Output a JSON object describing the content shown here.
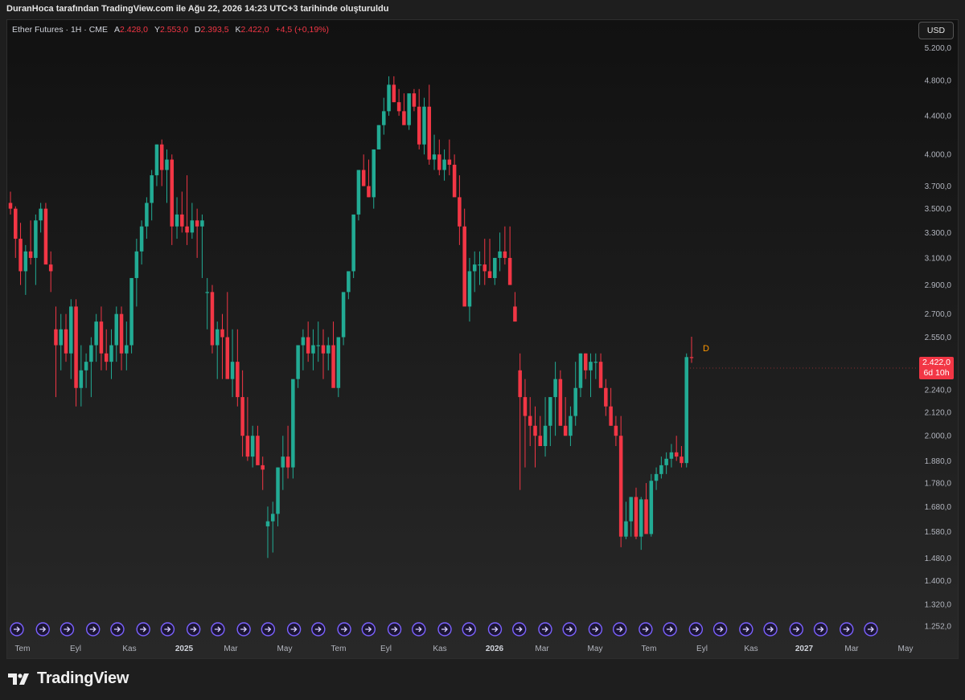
{
  "header": {
    "caption": "DuranHoca tarafından TradingView.com ile Ağu 22, 2026 14:23 UTC+3 tarihinde oluşturuldu"
  },
  "legend": {
    "symbol": "Ether Futures · 1H · CME",
    "open_label": "A",
    "open": "2.428,0",
    "high_label": "Y",
    "high": "2.553,0",
    "low_label": "D",
    "low": "2.393,5",
    "close_label": "K",
    "close": "2.422,0",
    "change": "+4,5 (+0,19%)"
  },
  "currency_button": "USD",
  "last_price": {
    "value": "2.422,0",
    "countdown": "6d 10h"
  },
  "marker_label": "D",
  "branding": {
    "logo_text": "TradingView"
  },
  "colors": {
    "up": "#22ab94",
    "down": "#f23645",
    "event_icon": "#7b61ff",
    "marker": "#ff9800"
  },
  "event_icons": {
    "icon": "arrow-circle-icon",
    "count": 35
  },
  "chart_data": {
    "type": "candlestick",
    "yscale": "log",
    "ylim": [
      1210,
      5450
    ],
    "y_ticks": [
      "5.200,0",
      "4.800,0",
      "4.400,0",
      "4.000,0",
      "3.700,0",
      "3.500,0",
      "3.300,0",
      "3.100,0",
      "2.900,0",
      "2.700,0",
      "2.550,0",
      "2.240,0",
      "2.120,0",
      "2.000,0",
      "1.880,0",
      "1.780,0",
      "1.680,0",
      "1.580,0",
      "1.480,0",
      "1.400,0",
      "1.320,0",
      "1.252,0"
    ],
    "x_ticks": [
      {
        "label": "Tem",
        "bold": false
      },
      {
        "label": "Eyl",
        "bold": false
      },
      {
        "label": "Kas",
        "bold": false
      },
      {
        "label": "2025",
        "bold": true
      },
      {
        "label": "Mar",
        "bold": false
      },
      {
        "label": "May",
        "bold": false
      },
      {
        "label": "Tem",
        "bold": false
      },
      {
        "label": "Eyl",
        "bold": false
      },
      {
        "label": "Kas",
        "bold": false
      },
      {
        "label": "2026",
        "bold": true
      },
      {
        "label": "Mar",
        "bold": false
      },
      {
        "label": "May",
        "bold": false
      },
      {
        "label": "Tem",
        "bold": false
      },
      {
        "label": "Eyl",
        "bold": false
      },
      {
        "label": "Kas",
        "bold": false
      },
      {
        "label": "2027",
        "bold": true
      },
      {
        "label": "Mar",
        "bold": false
      },
      {
        "label": "May",
        "bold": false
      }
    ],
    "candles": [
      [
        3550,
        3650,
        3450,
        3500
      ],
      [
        3500,
        3520,
        3100,
        3250
      ],
      [
        3250,
        3380,
        2900,
        3000
      ],
      [
        3000,
        3200,
        2830,
        3150
      ],
      [
        3150,
        3400,
        3050,
        3100
      ],
      [
        3100,
        3450,
        2900,
        3400
      ],
      [
        3400,
        3550,
        3300,
        3500
      ],
      [
        3500,
        3550,
        3100,
        3050
      ],
      [
        3050,
        3150,
        2850,
        3000
      ],
      [
        2600,
        2750,
        2200,
        2500
      ],
      [
        2500,
        2700,
        2350,
        2600
      ],
      [
        2600,
        2700,
        2400,
        2450
      ],
      [
        2450,
        2800,
        2300,
        2750
      ],
      [
        2750,
        2800,
        2150,
        2250
      ],
      [
        2250,
        2500,
        2150,
        2350
      ],
      [
        2350,
        2450,
        2250,
        2400
      ],
      [
        2400,
        2550,
        2200,
        2500
      ],
      [
        2500,
        2700,
        2400,
        2650
      ],
      [
        2650,
        2750,
        2350,
        2450
      ],
      [
        2450,
        2600,
        2350,
        2400
      ],
      [
        2400,
        2600,
        2300,
        2500
      ],
      [
        2500,
        2750,
        2400,
        2700
      ],
      [
        2700,
        2750,
        2350,
        2450
      ],
      [
        2450,
        2650,
        2350,
        2500
      ],
      [
        2500,
        2950,
        2450,
        2950
      ],
      [
        2950,
        3250,
        2750,
        3150
      ],
      [
        3150,
        3400,
        3050,
        3350
      ],
      [
        3350,
        3600,
        3250,
        3550
      ],
      [
        3550,
        3850,
        3400,
        3800
      ],
      [
        3800,
        4100,
        3700,
        4100
      ],
      [
        4100,
        4150,
        3700,
        3850
      ],
      [
        3850,
        4050,
        3550,
        3950
      ],
      [
        3950,
        4000,
        3200,
        3350
      ],
      [
        3350,
        3600,
        3250,
        3450
      ],
      [
        3450,
        3650,
        3300,
        3350
      ],
      [
        3350,
        3800,
        3200,
        3300
      ],
      [
        3300,
        3550,
        3250,
        3400
      ],
      [
        3400,
        3500,
        3100,
        3350
      ],
      [
        3350,
        3450,
        2950,
        3400
      ],
      [
        2850,
        2950,
        2600,
        2850
      ],
      [
        2850,
        2900,
        2450,
        2500
      ],
      [
        2500,
        2650,
        2300,
        2600
      ],
      [
        2600,
        2700,
        2300,
        2550
      ],
      [
        2550,
        2850,
        2500,
        2300
      ],
      [
        2300,
        2600,
        2200,
        2400
      ],
      [
        2400,
        2600,
        2150,
        2200
      ],
      [
        2200,
        2350,
        1900,
        2000
      ],
      [
        2000,
        2200,
        1880,
        1900
      ],
      [
        1900,
        2050,
        1850,
        2000
      ],
      [
        2000,
        2050,
        1880,
        1860
      ],
      [
        1860,
        1900,
        1750,
        1840
      ],
      [
        1600,
        1680,
        1480,
        1620
      ],
      [
        1620,
        1700,
        1500,
        1650
      ],
      [
        1650,
        1850,
        1600,
        1850
      ],
      [
        1850,
        2000,
        1750,
        1900
      ],
      [
        1900,
        2050,
        1800,
        1850
      ],
      [
        1850,
        2250,
        1800,
        2300
      ],
      [
        2300,
        2500,
        2250,
        2500
      ],
      [
        2500,
        2600,
        2350,
        2550
      ],
      [
        2550,
        2650,
        2400,
        2450
      ],
      [
        2450,
        2600,
        2350,
        2500
      ],
      [
        2500,
        2650,
        2400,
        2500
      ],
      [
        2500,
        2600,
        2300,
        2450
      ],
      [
        2450,
        2550,
        2350,
        2500
      ],
      [
        2500,
        2650,
        2400,
        2250
      ],
      [
        2250,
        2550,
        2200,
        2550
      ],
      [
        2550,
        2800,
        2500,
        2850
      ],
      [
        2850,
        3000,
        2800,
        3000
      ],
      [
        3000,
        3350,
        2950,
        3450
      ],
      [
        3450,
        3800,
        3400,
        3850
      ],
      [
        3850,
        4000,
        3700,
        3700
      ],
      [
        3700,
        3950,
        3600,
        3600
      ],
      [
        3600,
        4050,
        3500,
        4050
      ],
      [
        4050,
        4300,
        4050,
        4300
      ],
      [
        4300,
        4600,
        4200,
        4450
      ],
      [
        4450,
        4850,
        4400,
        4750
      ],
      [
        4750,
        4850,
        4550,
        4550
      ],
      [
        4550,
        4700,
        4400,
        4450
      ],
      [
        4450,
        4650,
        4350,
        4300
      ],
      [
        4300,
        4600,
        4250,
        4650
      ],
      [
        4650,
        4700,
        4450,
        4500
      ],
      [
        4500,
        4700,
        4050,
        4100
      ],
      [
        4100,
        4600,
        4000,
        4500
      ],
      [
        4500,
        4750,
        3900,
        3950
      ],
      [
        3950,
        4200,
        3850,
        4000
      ],
      [
        4000,
        4150,
        3800,
        3850
      ],
      [
        3850,
        4050,
        3750,
        3950
      ],
      [
        3950,
        4150,
        3800,
        3900
      ],
      [
        3900,
        4000,
        3750,
        3600
      ],
      [
        3600,
        3800,
        3200,
        3350
      ],
      [
        3350,
        3500,
        3000,
        2750
      ],
      [
        2750,
        3100,
        2650,
        3000
      ],
      [
        3000,
        3150,
        2850,
        3050
      ],
      [
        3050,
        3150,
        2900,
        3050
      ],
      [
        3050,
        3250,
        2900,
        3000
      ],
      [
        3000,
        3250,
        2950,
        2950
      ],
      [
        2950,
        3100,
        2900,
        3100
      ],
      [
        3100,
        3300,
        3000,
        3150
      ],
      [
        3150,
        3350,
        3050,
        3100
      ],
      [
        3100,
        3350,
        2900,
        2900
      ],
      [
        2750,
        2850,
        2650,
        2650
      ],
      [
        2350,
        2450,
        1750,
        2200
      ],
      [
        2200,
        2300,
        1850,
        2100
      ],
      [
        2100,
        2200,
        1950,
        2050
      ],
      [
        2050,
        2150,
        1850,
        2000
      ],
      [
        2000,
        2100,
        1950,
        1950
      ],
      [
        1950,
        2200,
        1900,
        2050
      ],
      [
        2050,
        2200,
        1950,
        2200
      ],
      [
        2200,
        2400,
        2000,
        2300
      ],
      [
        2300,
        2350,
        2050,
        2050
      ],
      [
        2050,
        2200,
        2000,
        2000
      ],
      [
        2000,
        2150,
        1950,
        2100
      ],
      [
        2100,
        2400,
        2050,
        2250
      ],
      [
        2250,
        2450,
        2200,
        2450
      ],
      [
        2450,
        2450,
        2300,
        2350
      ],
      [
        2350,
        2450,
        2200,
        2400
      ],
      [
        2400,
        2450,
        2300,
        2400
      ],
      [
        2400,
        2450,
        2300,
        2250
      ],
      [
        2250,
        2300,
        2100,
        2150
      ],
      [
        2150,
        2250,
        2050,
        2050
      ],
      [
        2050,
        2100,
        1950,
        2000
      ],
      [
        2000,
        2100,
        1520,
        1560
      ],
      [
        1560,
        1700,
        1550,
        1620
      ],
      [
        1620,
        1720,
        1560,
        1720
      ],
      [
        1720,
        1760,
        1550,
        1560
      ],
      [
        1560,
        1720,
        1510,
        1710
      ],
      [
        1710,
        1780,
        1580,
        1570
      ],
      [
        1570,
        1820,
        1560,
        1790
      ],
      [
        1790,
        1850,
        1750,
        1820
      ],
      [
        1820,
        1900,
        1800,
        1860
      ],
      [
        1860,
        1920,
        1820,
        1890
      ],
      [
        1890,
        1960,
        1850,
        1920
      ],
      [
        1920,
        2000,
        1880,
        1900
      ],
      [
        1900,
        1950,
        1850,
        1870
      ],
      [
        1870,
        2450,
        1850,
        2428
      ],
      [
        2428,
        2553,
        2393.5,
        2422
      ]
    ]
  }
}
